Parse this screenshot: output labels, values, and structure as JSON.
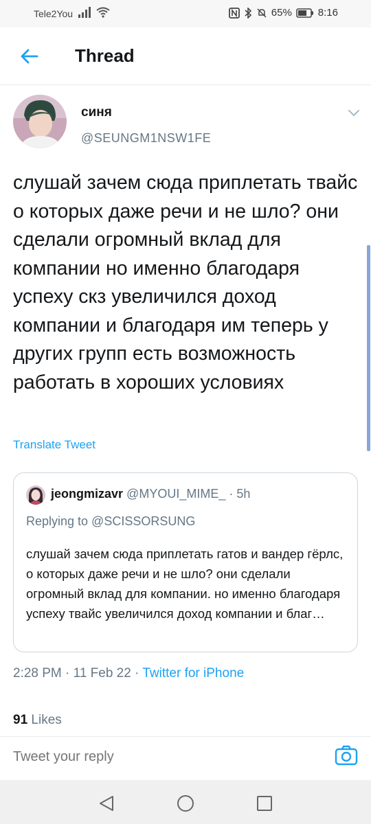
{
  "status_bar": {
    "carrier": "Tele2You",
    "battery": "65%",
    "time": "8:16"
  },
  "header": {
    "title": "Thread",
    "back_icon": "arrow-left-icon"
  },
  "tweet": {
    "display_name": "синя",
    "handle": "@SEUNGM1NSW1FE",
    "text": "слушай зачем сюда приплетать твайс о которых даже речи и не шло? они сделали огромный вклад для компании но именно благодаря успеху скз увеличился доход компании и благодаря им теперь у других групп есть возможность работать в хороших условиях",
    "translate_label": "Translate Tweet",
    "time": "2:28 PM",
    "date": "11 Feb 22",
    "source": "Twitter for iPhone",
    "likes_count": "91",
    "likes_label": "Likes"
  },
  "quote": {
    "display_name": "jeongmizavr",
    "handle": "@MYOUI_MIME_",
    "age": "5h",
    "replying_to": "Replying to @SCISSORSUNG",
    "text": "слушай зачем сюда приплетать гатов и вандер гёрлс, о которых даже речи и не шло? они сделали огромный вклад для компании. но именно благодаря успеху твайс увеличился доход компании и благ…"
  },
  "reply": {
    "placeholder": "Tweet your reply",
    "camera_icon": "camera-icon"
  },
  "colors": {
    "accent": "#1da1f2",
    "secondary_text": "#657786",
    "border": "#e6ecf0"
  }
}
